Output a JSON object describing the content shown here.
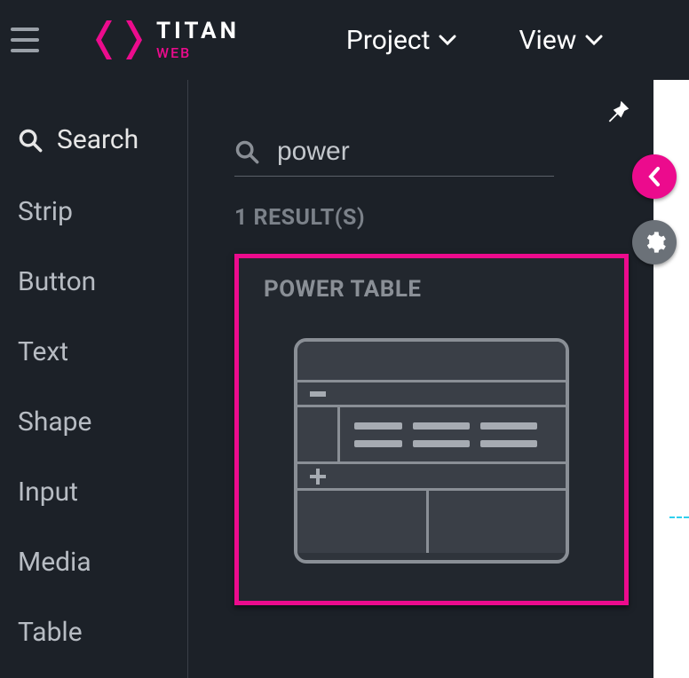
{
  "brand": {
    "name": "TITAN",
    "subname": "WEB",
    "accent": "#ec0b8d"
  },
  "header": {
    "menus": [
      {
        "label": "Project"
      },
      {
        "label": "View"
      }
    ]
  },
  "sidebar": {
    "search_label": "Search",
    "items": [
      {
        "label": "Strip"
      },
      {
        "label": "Button"
      },
      {
        "label": "Text"
      },
      {
        "label": "Shape"
      },
      {
        "label": "Input"
      },
      {
        "label": "Media"
      },
      {
        "label": "Table"
      }
    ]
  },
  "panel": {
    "search_value": "power",
    "results_label": "1 RESULT(S)",
    "result": {
      "title": "POWER TABLE"
    }
  }
}
